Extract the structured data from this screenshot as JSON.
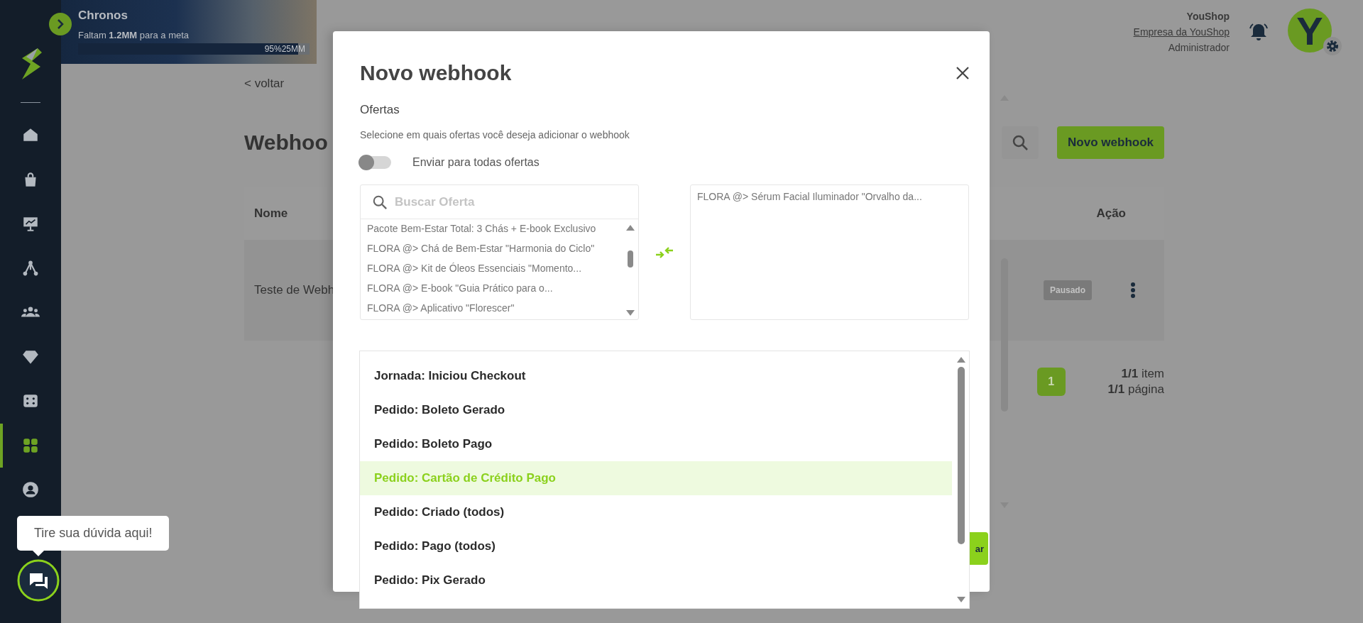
{
  "sidebar": {
    "items": [
      {
        "kind": "home",
        "selected": false
      },
      {
        "kind": "bag",
        "selected": false
      },
      {
        "kind": "board",
        "selected": false
      },
      {
        "kind": "network",
        "selected": false
      },
      {
        "kind": "people",
        "selected": false
      },
      {
        "kind": "diamond",
        "selected": false
      },
      {
        "kind": "dice",
        "selected": false
      },
      {
        "kind": "grid",
        "selected": true
      },
      {
        "kind": "user",
        "selected": false
      }
    ]
  },
  "banner": {
    "title": "Chronos",
    "subtitle": "Faltam **1.2MM** para a meta",
    "progress": {
      "level": 0.95,
      "percent": "95%",
      "goal": "25MM"
    }
  },
  "header": {
    "company": "YouShop",
    "company_link": "Empresa da YouShop",
    "role": "Administrador",
    "avatar_letter": "Y"
  },
  "page": {
    "back_link": "< voltar",
    "title": "Webhoo",
    "new_button": "Novo webhook",
    "table": {
      "columns": [
        "Nome",
        "Ação"
      ],
      "rows": [
        {
          "name": "Teste de Webh",
          "status": "Pausado"
        }
      ]
    },
    "pagination": {
      "pages": [
        {
          "label": "1",
          "selected": true
        }
      ],
      "items_count": "**1/1** item",
      "pages_count": "**1/1** página"
    }
  },
  "modal": {
    "title": "Novo webhook",
    "section": "Ofertas",
    "description": "Selecione em quais ofertas você deseja adicionar o webhook",
    "send_all": {
      "label": "Enviar para todas ofertas",
      "on": false
    },
    "search_placeholder": "Buscar Oferta",
    "available_offers": [
      "Pacote Bem-Estar Total: 3 Chás + E-book Exclusivo",
      "FLORA @> Chá de Bem-Estar \"Harmonia do Ciclo\"",
      "FLORA @> Kit de Óleos Essenciais \"Momento...",
      "FLORA @> E-book \"Guia Prático para o...",
      "FLORA @> Aplicativo \"Florescer\""
    ],
    "selected_offers": [
      "FLORA @> Sérum Facial Iluminador \"Orvalho da..."
    ],
    "save_button": "ar"
  },
  "event_dropdown": {
    "options": [
      {
        "label": "Jornada: Iniciou Checkout",
        "selected": false
      },
      {
        "label": "Pedido: Boleto Gerado",
        "selected": false
      },
      {
        "label": "Pedido: Boleto Pago",
        "selected": false
      },
      {
        "label": "Pedido: Cartão de Crédito Pago",
        "selected": true
      },
      {
        "label": "Pedido: Criado (todos)",
        "selected": false
      },
      {
        "label": "Pedido: Pago (todos)",
        "selected": false
      },
      {
        "label": "Pedido: Pix Gerado",
        "selected": false
      }
    ]
  },
  "chat": {
    "tooltip": "Tire sua dúvida aqui!"
  }
}
